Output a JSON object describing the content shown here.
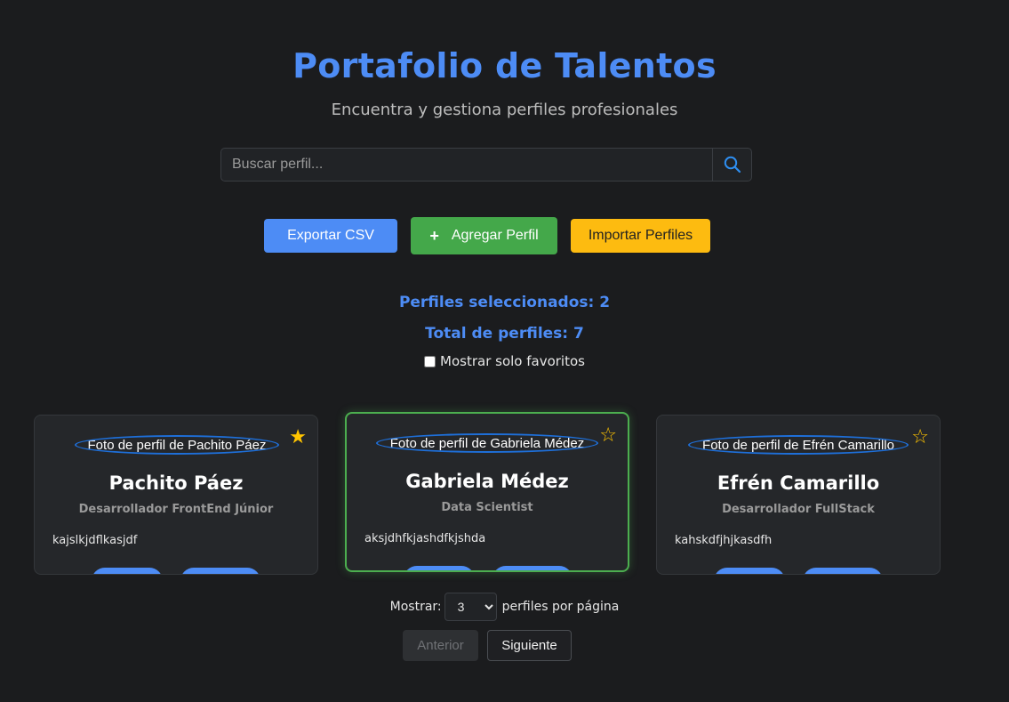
{
  "header": {
    "title": "Portafolio de Talentos",
    "subtitle": "Encuentra y gestiona perfiles profesionales"
  },
  "search": {
    "placeholder": "Buscar perfil...",
    "value": "",
    "icon": "search-icon"
  },
  "actions": {
    "export_label": "Exportar CSV",
    "add_icon": "+",
    "add_label": "Agregar Perfil",
    "import_label": "Importar Perfiles"
  },
  "stats": {
    "selected": "Perfiles seleccionados: 2",
    "total": "Total de perfiles: 7",
    "favorites_filter_label": "Mostrar solo favoritos",
    "favorites_filter_checked": false
  },
  "profiles": [
    {
      "photo_alt": "Foto de perfil de Pachito Páez",
      "name": "Pachito Páez",
      "role": "Desarrollador FrontEnd Júnior",
      "description": "kajslkjdflkasjdf",
      "favorite_symbol": "★",
      "favorite": true,
      "selected": false
    },
    {
      "photo_alt": "Foto de perfil de Gabriela Médez",
      "name": "Gabriela Médez",
      "role": "Data Scientist",
      "description": "aksjdhfkjashdfkjshda",
      "favorite_symbol": "☆",
      "favorite": false,
      "selected": true
    },
    {
      "photo_alt": "Foto de perfil de Efrén Camarillo",
      "name": "Efrén Camarillo",
      "role": "Desarrollador FullStack",
      "description": "kahskdfjhjkasdfh",
      "favorite_symbol": "☆",
      "favorite": false,
      "selected": false
    }
  ],
  "pagination": {
    "show_label": "Mostrar:",
    "per_page_value": "3",
    "per_page_suffix": "perfiles por página",
    "prev_label": "Anterior",
    "next_label": "Siguiente"
  },
  "colors": {
    "accent": "#4d8cf5",
    "success": "#44a84a",
    "warning": "#fdbb10",
    "background": "#1b1c1e",
    "card": "#25272a",
    "star": "#ffc400"
  }
}
